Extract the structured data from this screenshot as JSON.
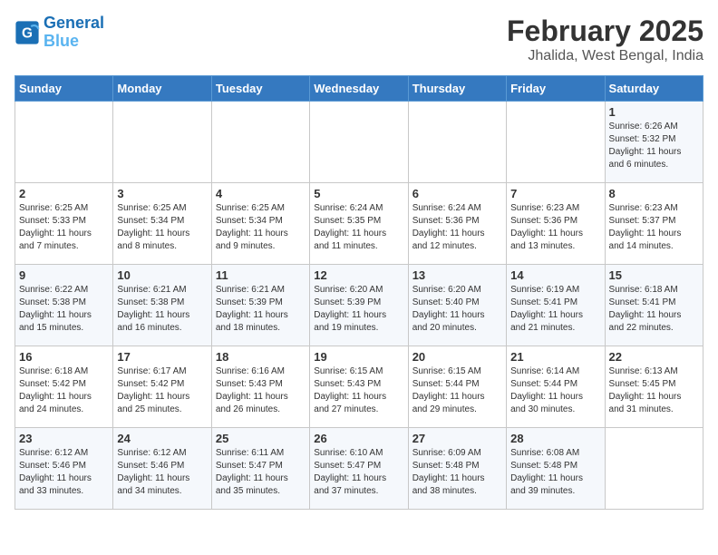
{
  "header": {
    "logo_line1": "General",
    "logo_line2": "Blue",
    "title": "February 2025",
    "subtitle": "Jhalida, West Bengal, India"
  },
  "weekdays": [
    "Sunday",
    "Monday",
    "Tuesday",
    "Wednesday",
    "Thursday",
    "Friday",
    "Saturday"
  ],
  "weeks": [
    [
      {
        "day": "",
        "info": ""
      },
      {
        "day": "",
        "info": ""
      },
      {
        "day": "",
        "info": ""
      },
      {
        "day": "",
        "info": ""
      },
      {
        "day": "",
        "info": ""
      },
      {
        "day": "",
        "info": ""
      },
      {
        "day": "1",
        "info": "Sunrise: 6:26 AM\nSunset: 5:32 PM\nDaylight: 11 hours\nand 6 minutes."
      }
    ],
    [
      {
        "day": "2",
        "info": "Sunrise: 6:25 AM\nSunset: 5:33 PM\nDaylight: 11 hours\nand 7 minutes."
      },
      {
        "day": "3",
        "info": "Sunrise: 6:25 AM\nSunset: 5:34 PM\nDaylight: 11 hours\nand 8 minutes."
      },
      {
        "day": "4",
        "info": "Sunrise: 6:25 AM\nSunset: 5:34 PM\nDaylight: 11 hours\nand 9 minutes."
      },
      {
        "day": "5",
        "info": "Sunrise: 6:24 AM\nSunset: 5:35 PM\nDaylight: 11 hours\nand 11 minutes."
      },
      {
        "day": "6",
        "info": "Sunrise: 6:24 AM\nSunset: 5:36 PM\nDaylight: 11 hours\nand 12 minutes."
      },
      {
        "day": "7",
        "info": "Sunrise: 6:23 AM\nSunset: 5:36 PM\nDaylight: 11 hours\nand 13 minutes."
      },
      {
        "day": "8",
        "info": "Sunrise: 6:23 AM\nSunset: 5:37 PM\nDaylight: 11 hours\nand 14 minutes."
      }
    ],
    [
      {
        "day": "9",
        "info": "Sunrise: 6:22 AM\nSunset: 5:38 PM\nDaylight: 11 hours\nand 15 minutes."
      },
      {
        "day": "10",
        "info": "Sunrise: 6:21 AM\nSunset: 5:38 PM\nDaylight: 11 hours\nand 16 minutes."
      },
      {
        "day": "11",
        "info": "Sunrise: 6:21 AM\nSunset: 5:39 PM\nDaylight: 11 hours\nand 18 minutes."
      },
      {
        "day": "12",
        "info": "Sunrise: 6:20 AM\nSunset: 5:39 PM\nDaylight: 11 hours\nand 19 minutes."
      },
      {
        "day": "13",
        "info": "Sunrise: 6:20 AM\nSunset: 5:40 PM\nDaylight: 11 hours\nand 20 minutes."
      },
      {
        "day": "14",
        "info": "Sunrise: 6:19 AM\nSunset: 5:41 PM\nDaylight: 11 hours\nand 21 minutes."
      },
      {
        "day": "15",
        "info": "Sunrise: 6:18 AM\nSunset: 5:41 PM\nDaylight: 11 hours\nand 22 minutes."
      }
    ],
    [
      {
        "day": "16",
        "info": "Sunrise: 6:18 AM\nSunset: 5:42 PM\nDaylight: 11 hours\nand 24 minutes."
      },
      {
        "day": "17",
        "info": "Sunrise: 6:17 AM\nSunset: 5:42 PM\nDaylight: 11 hours\nand 25 minutes."
      },
      {
        "day": "18",
        "info": "Sunrise: 6:16 AM\nSunset: 5:43 PM\nDaylight: 11 hours\nand 26 minutes."
      },
      {
        "day": "19",
        "info": "Sunrise: 6:15 AM\nSunset: 5:43 PM\nDaylight: 11 hours\nand 27 minutes."
      },
      {
        "day": "20",
        "info": "Sunrise: 6:15 AM\nSunset: 5:44 PM\nDaylight: 11 hours\nand 29 minutes."
      },
      {
        "day": "21",
        "info": "Sunrise: 6:14 AM\nSunset: 5:44 PM\nDaylight: 11 hours\nand 30 minutes."
      },
      {
        "day": "22",
        "info": "Sunrise: 6:13 AM\nSunset: 5:45 PM\nDaylight: 11 hours\nand 31 minutes."
      }
    ],
    [
      {
        "day": "23",
        "info": "Sunrise: 6:12 AM\nSunset: 5:46 PM\nDaylight: 11 hours\nand 33 minutes."
      },
      {
        "day": "24",
        "info": "Sunrise: 6:12 AM\nSunset: 5:46 PM\nDaylight: 11 hours\nand 34 minutes."
      },
      {
        "day": "25",
        "info": "Sunrise: 6:11 AM\nSunset: 5:47 PM\nDaylight: 11 hours\nand 35 minutes."
      },
      {
        "day": "26",
        "info": "Sunrise: 6:10 AM\nSunset: 5:47 PM\nDaylight: 11 hours\nand 37 minutes."
      },
      {
        "day": "27",
        "info": "Sunrise: 6:09 AM\nSunset: 5:48 PM\nDaylight: 11 hours\nand 38 minutes."
      },
      {
        "day": "28",
        "info": "Sunrise: 6:08 AM\nSunset: 5:48 PM\nDaylight: 11 hours\nand 39 minutes."
      },
      {
        "day": "",
        "info": ""
      }
    ]
  ]
}
